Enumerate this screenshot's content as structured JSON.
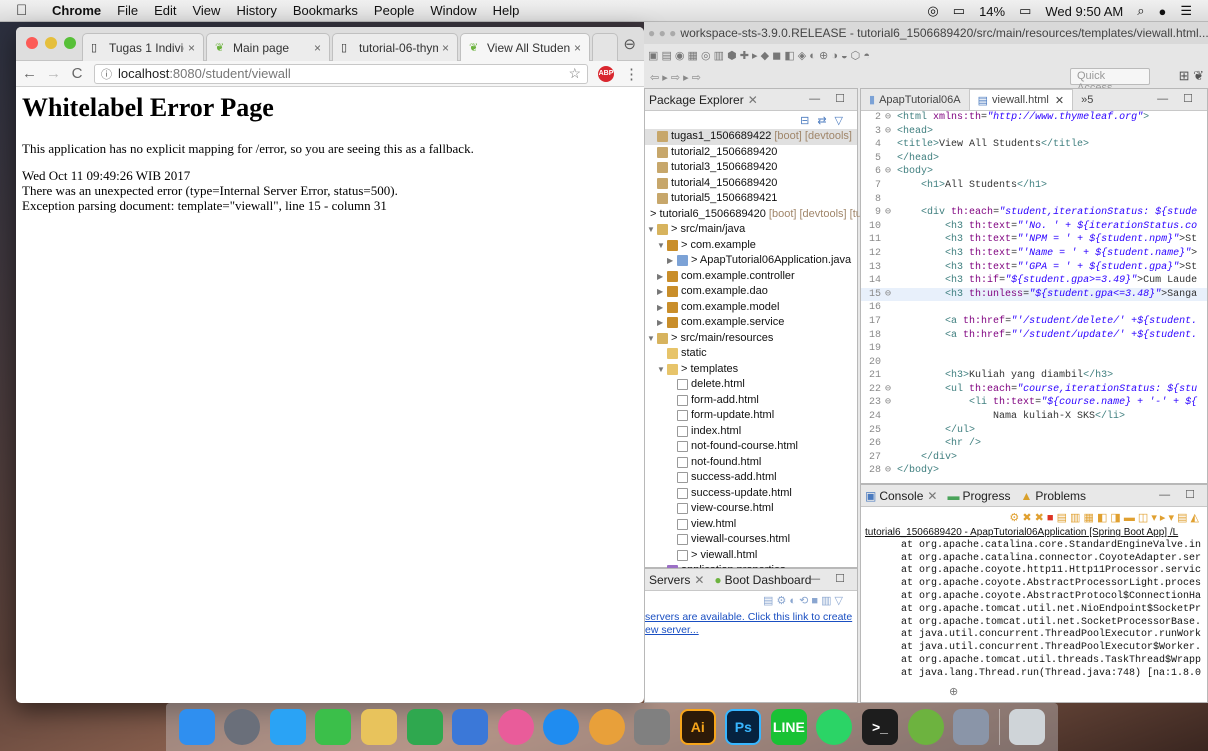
{
  "menubar": {
    "app": "Chrome",
    "items": [
      "File",
      "Edit",
      "View",
      "History",
      "Bookmarks",
      "People",
      "Window",
      "Help"
    ],
    "battery": "14%",
    "clock": "Wed 9:50 AM"
  },
  "chrome": {
    "tabs": [
      {
        "title": "Tugas 1 Individu",
        "active": false
      },
      {
        "title": "Main page",
        "active": false
      },
      {
        "title": "tutorial-06-thym",
        "active": false
      },
      {
        "title": "View All Students",
        "active": true
      }
    ],
    "url_host": "localhost",
    "url_rest": ":8080/student/viewall",
    "abp_label": "ABP",
    "page": {
      "heading": "Whitelabel Error Page",
      "line1": "This application has no explicit mapping for /error, so you are seeing this as a fallback.",
      "line2": "Wed Oct 11 09:49:26 WIB 2017",
      "line3": "There was an unexpected error (type=Internal Server Error, status=500).",
      "line4": "Exception parsing document: template=\"viewall\", line 15 - column 31"
    }
  },
  "eclipse": {
    "title": "workspace-sts-3.9.0.RELEASE - tutorial6_1506689420/src/main/resources/templates/viewall.html...",
    "quick_access": "Quick Access",
    "package_explorer": {
      "title": "Package Explorer",
      "rows": [
        {
          "indent": 0,
          "arrow": "",
          "icon": "proj",
          "label": "tugas1_1506689422",
          "deco": "[boot] [devtools]",
          "sel": true
        },
        {
          "indent": 0,
          "arrow": "",
          "icon": "proj",
          "label": "tutorial2_1506689420",
          "deco": ""
        },
        {
          "indent": 0,
          "arrow": "",
          "icon": "proj",
          "label": "tutorial3_1506689420",
          "deco": ""
        },
        {
          "indent": 0,
          "arrow": "",
          "icon": "proj",
          "label": "tutorial4_1506689420",
          "deco": ""
        },
        {
          "indent": 0,
          "arrow": "",
          "icon": "proj",
          "label": "tutorial5_1506689421",
          "deco": ""
        },
        {
          "indent": 0,
          "arrow": "",
          "icon": "proj",
          "label": "> tutorial6_1506689420",
          "deco": "[boot] [devtools] [tu"
        },
        {
          "indent": 0,
          "arrow": "▼",
          "icon": "src",
          "label": "> src/main/java",
          "deco": ""
        },
        {
          "indent": 1,
          "arrow": "▼",
          "icon": "pkg",
          "label": "> com.example",
          "deco": ""
        },
        {
          "indent": 2,
          "arrow": "▶",
          "icon": "java",
          "label": "> ApapTutorial06Application.java",
          "deco": ""
        },
        {
          "indent": 1,
          "arrow": "▶",
          "icon": "pkg",
          "label": "com.example.controller",
          "deco": ""
        },
        {
          "indent": 1,
          "arrow": "▶",
          "icon": "pkg",
          "label": "com.example.dao",
          "deco": ""
        },
        {
          "indent": 1,
          "arrow": "▶",
          "icon": "pkg",
          "label": "com.example.model",
          "deco": ""
        },
        {
          "indent": 1,
          "arrow": "▶",
          "icon": "pkg",
          "label": "com.example.service",
          "deco": ""
        },
        {
          "indent": 0,
          "arrow": "▼",
          "icon": "src",
          "label": "> src/main/resources",
          "deco": ""
        },
        {
          "indent": 1,
          "arrow": "",
          "icon": "fold",
          "label": "static",
          "deco": ""
        },
        {
          "indent": 1,
          "arrow": "▼",
          "icon": "fold",
          "label": "> templates",
          "deco": ""
        },
        {
          "indent": 2,
          "arrow": "",
          "icon": "file",
          "label": "delete.html",
          "deco": ""
        },
        {
          "indent": 2,
          "arrow": "",
          "icon": "file",
          "label": "form-add.html",
          "deco": ""
        },
        {
          "indent": 2,
          "arrow": "",
          "icon": "file",
          "label": "form-update.html",
          "deco": ""
        },
        {
          "indent": 2,
          "arrow": "",
          "icon": "file",
          "label": "index.html",
          "deco": ""
        },
        {
          "indent": 2,
          "arrow": "",
          "icon": "file",
          "label": "not-found-course.html",
          "deco": ""
        },
        {
          "indent": 2,
          "arrow": "",
          "icon": "file",
          "label": "not-found.html",
          "deco": ""
        },
        {
          "indent": 2,
          "arrow": "",
          "icon": "file",
          "label": "success-add.html",
          "deco": ""
        },
        {
          "indent": 2,
          "arrow": "",
          "icon": "file",
          "label": "success-update.html",
          "deco": ""
        },
        {
          "indent": 2,
          "arrow": "",
          "icon": "file",
          "label": "view-course.html",
          "deco": ""
        },
        {
          "indent": 2,
          "arrow": "",
          "icon": "file",
          "label": "view.html",
          "deco": ""
        },
        {
          "indent": 2,
          "arrow": "",
          "icon": "file",
          "label": "viewall-courses.html",
          "deco": ""
        },
        {
          "indent": 2,
          "arrow": "",
          "icon": "file",
          "label": "> viewall.html",
          "deco": ""
        },
        {
          "indent": 1,
          "arrow": "",
          "icon": "prop",
          "label": "application.properties",
          "deco": ""
        },
        {
          "indent": 0,
          "arrow": "▶",
          "icon": "src",
          "label": "src/test/java",
          "deco": ""
        }
      ]
    },
    "servers": {
      "tab1": "Servers",
      "tab2": "Boot Dashboard",
      "link_line1": "servers are available. Click this link to create",
      "link_line2": "ew server..."
    },
    "editor": {
      "tab1": "ApapTutorial06A",
      "tab2": "viewall.html",
      "tab_more": "»5",
      "lines": [
        {
          "n": "2",
          "m": "⊖",
          "html": "<span class='tag'>&lt;html</span> <span class='at'>xmlns:th</span>=<span class='str'>\"http://www.thymeleaf.org\"</span><span class='tag'>&gt;</span>"
        },
        {
          "n": "3",
          "m": "⊖",
          "html": "<span class='tag'>&lt;head&gt;</span>"
        },
        {
          "n": "4",
          "m": "",
          "html": "<span class='tag'>&lt;title&gt;</span>View All Students<span class='tag'>&lt;/title&gt;</span>"
        },
        {
          "n": "5",
          "m": "",
          "html": "<span class='tag'>&lt;/head&gt;</span>"
        },
        {
          "n": "6",
          "m": "⊖",
          "html": "<span class='tag'>&lt;body&gt;</span>"
        },
        {
          "n": "7",
          "m": "",
          "html": "    <span class='tag'>&lt;h1&gt;</span>All Students<span class='tag'>&lt;/h1&gt;</span>"
        },
        {
          "n": "8",
          "m": "",
          "html": ""
        },
        {
          "n": "9",
          "m": "⊖",
          "html": "    <span class='tag'>&lt;div</span> <span class='at'>th:each</span>=<span class='str'>\"student,iterationStatus: ${stude</span>"
        },
        {
          "n": "10",
          "m": "",
          "html": "        <span class='tag'>&lt;h3</span> <span class='at'>th:text</span>=<span class='str'>\"'No. ' + ${iterationStatus.co</span>"
        },
        {
          "n": "11",
          "m": "",
          "html": "        <span class='tag'>&lt;h3</span> <span class='at'>th:text</span>=<span class='str'>\"'NPM = ' + ${student.npm}\"</span>&gt;St"
        },
        {
          "n": "12",
          "m": "",
          "html": "        <span class='tag'>&lt;h3</span> <span class='at'>th:text</span>=<span class='str'>\"'Name = ' + ${student.name}\"</span>&gt;"
        },
        {
          "n": "13",
          "m": "",
          "html": "        <span class='tag'>&lt;h3</span> <span class='at'>th:text</span>=<span class='str'>\"'GPA = ' + ${student.gpa}\"</span>&gt;St"
        },
        {
          "n": "14",
          "m": "",
          "html": "        <span class='tag'>&lt;h3</span> <span class='at'>th:if</span>=<span class='str'>\"${student.gpa&gt;=3.49}\"</span>&gt;Cum Laude"
        },
        {
          "n": "15",
          "m": "⊖",
          "hl": true,
          "html": "        <span class='tag'>&lt;h3</span> <span class='at'>th:unless</span>=<span class='str'>\"${student.gpa&lt;=3.48}\"</span>&gt;Sanga"
        },
        {
          "n": "16",
          "m": "",
          "html": ""
        },
        {
          "n": "17",
          "m": "",
          "html": "        <span class='tag'>&lt;a</span> <span class='at'>th:href</span>=<span class='str'>\"'/student/delete/' +${student.</span>"
        },
        {
          "n": "18",
          "m": "",
          "html": "        <span class='tag'>&lt;a</span> <span class='at'>th:href</span>=<span class='str'>\"'/student/update/' +${student.</span>"
        },
        {
          "n": "19",
          "m": "",
          "html": ""
        },
        {
          "n": "20",
          "m": "",
          "html": ""
        },
        {
          "n": "21",
          "m": "",
          "html": "        <span class='tag'>&lt;h3&gt;</span>Kuliah yang diambil<span class='tag'>&lt;/h3&gt;</span>"
        },
        {
          "n": "22",
          "m": "⊖",
          "html": "        <span class='tag'>&lt;ul</span> <span class='at'>th:each</span>=<span class='str'>\"course,iterationStatus: ${stu</span>"
        },
        {
          "n": "23",
          "m": "⊖",
          "html": "            <span class='tag'>&lt;li</span> <span class='at'>th:text</span>=<span class='str'>\"${course.name} + '-' + ${</span>"
        },
        {
          "n": "24",
          "m": "",
          "html": "                Nama kuliah-X SKS<span class='tag'>&lt;/li&gt;</span>"
        },
        {
          "n": "25",
          "m": "",
          "html": "        <span class='tag'>&lt;/ul&gt;</span>"
        },
        {
          "n": "26",
          "m": "",
          "html": "        <span class='tag'>&lt;hr /&gt;</span>"
        },
        {
          "n": "27",
          "m": "",
          "html": "    <span class='tag'>&lt;/div&gt;</span>"
        },
        {
          "n": "28",
          "m": "⊖",
          "html": "<span class='tag'>&lt;/body&gt;</span>"
        }
      ]
    },
    "console": {
      "tab1": "Console",
      "tab2": "Progress",
      "tab3": "Problems",
      "header": "tutorial6_1506689420 - ApapTutorial06Application [Spring Boot App] /L",
      "lines": [
        "      at org.apache.catalina.core.StandardEngineValve.in",
        "      at org.apache.catalina.connector.CoyoteAdapter.ser",
        "      at org.apache.coyote.http11.Http11Processor.servic",
        "      at org.apache.coyote.AbstractProcessorLight.proces",
        "      at org.apache.coyote.AbstractProtocol$ConnectionHa",
        "      at org.apache.tomcat.util.net.NioEndpoint$SocketPr",
        "      at org.apache.tomcat.util.net.SocketProcessorBase.",
        "      at java.util.concurrent.ThreadPoolExecutor.runWork",
        "      at java.util.concurrent.ThreadPoolExecutor$Worker.",
        "      at org.apache.tomcat.util.threads.TaskThread$Wrapp",
        "      at java.lang.Thread.run(Thread.java:748) [na:1.8.0"
      ]
    }
  },
  "dock": {
    "items": [
      {
        "name": "finder-icon",
        "label": "",
        "color": "#2f8ff0"
      },
      {
        "name": "launchpad-icon",
        "label": "",
        "color": "#6a6f7a"
      },
      {
        "name": "messages-icon",
        "label": "",
        "color": "#2aa3f5"
      },
      {
        "name": "facetime-icon",
        "label": "",
        "color": "#3bbf4a"
      },
      {
        "name": "texteditor-icon",
        "label": "",
        "color": "#e8c35c"
      },
      {
        "name": "numbers-icon",
        "label": "",
        "color": "#2fa84f"
      },
      {
        "name": "keynote-icon",
        "label": "",
        "color": "#3b78d8"
      },
      {
        "name": "itunes-icon",
        "label": "",
        "color": "#e95c9a"
      },
      {
        "name": "appstore-icon",
        "label": "",
        "color": "#1f8cf0"
      },
      {
        "name": "chrome-icon",
        "label": "",
        "color": "#e8a03a"
      },
      {
        "name": "diskutility-icon",
        "label": "",
        "color": "#808080"
      },
      {
        "name": "illustrator-icon",
        "label": "Ai",
        "color": "#2d1a08"
      },
      {
        "name": "photoshop-icon",
        "label": "Ps",
        "color": "#06223f"
      },
      {
        "name": "line-icon",
        "label": "LINE",
        "color": "#19c235"
      },
      {
        "name": "whatsapp-icon",
        "label": "",
        "color": "#2bd466"
      },
      {
        "name": "terminal-icon",
        "label": ">_",
        "color": "#1d1d1d"
      },
      {
        "name": "spring-icon",
        "label": "",
        "color": "#6db33f"
      },
      {
        "name": "preferences-icon",
        "label": "",
        "color": "#8a95a8"
      },
      {
        "name": "trash-icon",
        "label": "",
        "color": "#cfd4d8"
      }
    ]
  }
}
